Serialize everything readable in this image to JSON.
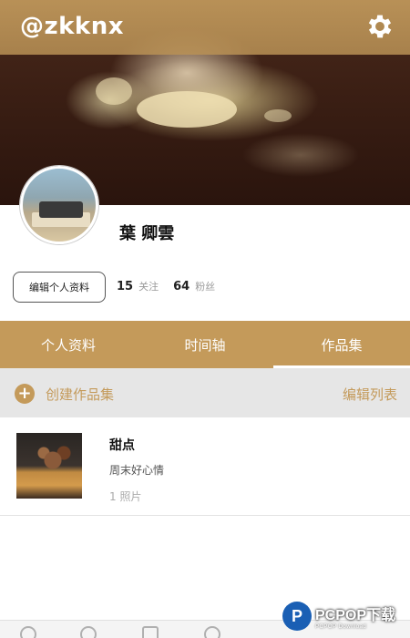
{
  "header": {
    "username": "@zkknx",
    "settings_icon": "gear-icon"
  },
  "profile": {
    "display_name": "葉 卿雲",
    "edit_button_label": "编辑个人资料",
    "following_count": "15",
    "following_label": "关注",
    "followers_count": "64",
    "followers_label": "粉丝"
  },
  "tabs": [
    {
      "label": "个人资料",
      "active": false
    },
    {
      "label": "时间轴",
      "active": false
    },
    {
      "label": "作品集",
      "active": true
    }
  ],
  "collection_bar": {
    "create_icon": "plus-circle-icon",
    "create_label": "创建作品集",
    "edit_list_label": "编辑列表"
  },
  "albums": [
    {
      "title": "甜点",
      "description": "周末好心情",
      "count": "1 照片"
    }
  ],
  "watermark": {
    "logo_letter": "P",
    "main": "PCPOP下载",
    "sub": "PCPOP Download"
  },
  "colors": {
    "accent": "#c49a5a",
    "tab_bar": "#c49a5a",
    "toolbar_bg": "#e6e6e6"
  },
  "bottom_nav": {
    "icons": [
      "home-icon",
      "search-icon",
      "camera-icon",
      "drop-icon"
    ]
  }
}
